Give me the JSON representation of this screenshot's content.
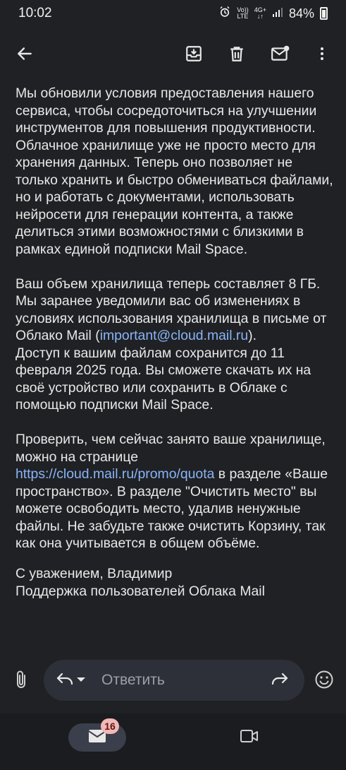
{
  "status_bar": {
    "time": "10:02",
    "network_top": "Vo))",
    "network_bottom": "LTE",
    "data_top": "4G+",
    "data_bottom": "↓↑",
    "battery": "84%"
  },
  "toolbar": {
    "back_icon": "arrow-back-icon",
    "archive_icon": "archive-icon",
    "delete_icon": "delete-icon",
    "mark_unread_icon": "mark-unread-icon",
    "more_icon": "more-vert-icon"
  },
  "email": {
    "p1": "Мы обновили условия предоставления нашего сервиса, чтобы сосредоточиться на улучшении инструментов для повышения продуктивности. Облачное хранилище уже не просто место для хранения данных. Теперь оно позволяет не только хранить и быстро обмениваться файлами, но и работать с документами, использовать нейросети для генерации контента, а также делиться этими возможностями с близкими в рамках единой подписки Mail Space.",
    "p2_part1": "Ваш объем хранилища теперь составляет 8 ГБ. Мы заранее уведомили вас об изменениях в условиях использования хранилища в письме от Облако Mail (",
    "p2_email_link": "important@cloud.mail.ru",
    "p2_part2": ").",
    "p2_line2": "Доступ к вашим файлам сохранится до 11 февраля 2025 года. Вы сможете скачать их на своё устройство или сохранить в Облаке с помощью подписки Mail Space.",
    "p3_part1": "Проверить, чем сейчас занято ваше хранилище, можно на странице",
    "p3_link": "https://cloud.mail.ru/promo/quota",
    "p3_part2": " в разделе «Ваше пространство». В разделе \"Очистить место\" вы можете освободить место, удалив ненужные файлы. Не забудьте также очистить Корзину, так как она учитывается в общем объёме.",
    "signature_line1": "С уважением, Владимир",
    "signature_line2": "Поддержка пользователей Облака Mail"
  },
  "reply_bar": {
    "attach_icon": "attach-icon",
    "reply_icon": "reply-icon",
    "dropdown_icon": "dropdown-icon",
    "reply_label": "Ответить",
    "forward_icon": "forward-icon",
    "emoji_icon": "emoji-icon"
  },
  "bottom_nav": {
    "mail_badge": "16",
    "mail_icon": "mail-icon",
    "meet_icon": "video-icon"
  },
  "colors": {
    "background": "#1f2124",
    "link": "#8ab4f8",
    "badge": "#f2b8b5"
  }
}
